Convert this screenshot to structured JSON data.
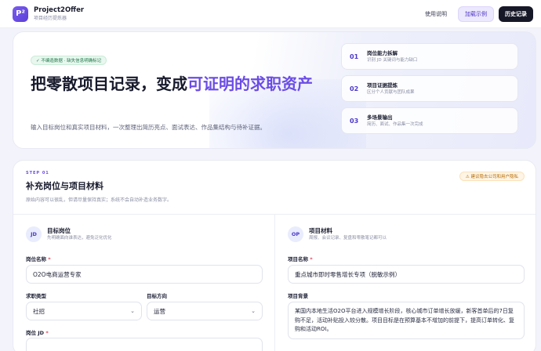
{
  "header": {
    "logo_text": "P²",
    "brand_name": "Project2Offer",
    "brand_sub": "项目经历提炼器",
    "nav": {
      "help": "使用说明",
      "load_example": "加载示例",
      "history": "历史记录"
    }
  },
  "hero": {
    "tag": "✓ 不编造数据 · 缺失信息明确标记",
    "title_plain": "把零散项目记录，变成",
    "title_accent": "可证明的求职资产",
    "description": "输入目标岗位和真实项目材料，一次整理出简历亮点、面试表达、作品集结构与待补证据。",
    "steps": [
      {
        "num": "01",
        "title": "岗位能力拆解",
        "sub": "识别 JD 关键词与能力缺口"
      },
      {
        "num": "02",
        "title": "项目证据提炼",
        "sub": "区分个人贡献与团队成果"
      },
      {
        "num": "03",
        "title": "多场景输出",
        "sub": "简历、面试、作品集一次完成"
      }
    ]
  },
  "form": {
    "step_label": "STEP 01",
    "title": "补充岗位与项目材料",
    "subtitle": "原始内容可以很乱，但请尽量保持真实；系统不会自动补造业务数字。",
    "warning": "⚠ 建议隐去公司和用户隐私",
    "left": {
      "icon_text": "JD",
      "title": "目标岗位",
      "subtitle": "先明确面向谁表达，避免泛化优化",
      "job_name_label": "岗位名称",
      "job_name_value": "O2O电商运营专家",
      "job_type_label": "求职类型",
      "job_type_value": "社招",
      "direction_label": "目标方向",
      "direction_value": "运营",
      "jd_label": "岗位 JD",
      "required_mark": "*"
    },
    "right": {
      "icon_text": "OP",
      "title": "项目材料",
      "subtitle": "周报、会议记录、复盘和零散笔记都可以",
      "project_name_label": "项目名称",
      "project_name_value": "重点城市即时零售增长专项（脱敏示例）",
      "background_label": "项目背景",
      "background_value": "某国内本地生活O2O平台进入规模增长阶段，核心城市订单增长放缓，新客首单后的7日复购不足，活动补贴投入较分散。项目目标是在预算基本不增加的前提下，提高订单转化、复购和活动ROI。"
    }
  }
}
